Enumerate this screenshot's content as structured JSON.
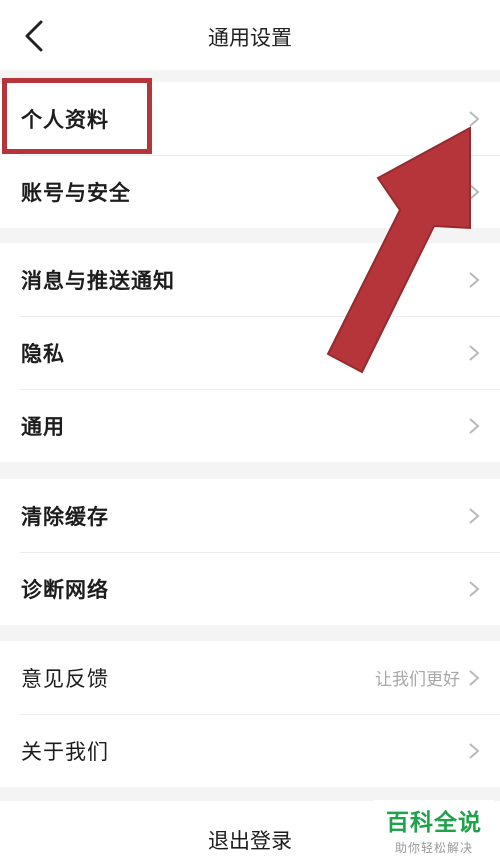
{
  "header": {
    "title": "通用设置"
  },
  "groups": [
    {
      "items": [
        {
          "label": "个人资料"
        },
        {
          "label": "账号与安全"
        }
      ]
    },
    {
      "items": [
        {
          "label": "消息与推送通知"
        },
        {
          "label": "隐私"
        },
        {
          "label": "通用"
        }
      ]
    },
    {
      "items": [
        {
          "label": "清除缓存"
        },
        {
          "label": "诊断网络"
        }
      ]
    },
    {
      "items": [
        {
          "label": "意见反馈",
          "hint": "让我们更好"
        },
        {
          "label": "关于我们"
        }
      ]
    }
  ],
  "logout": {
    "label": "退出登录"
  },
  "watermark": {
    "brand": "百科全说",
    "slogan": "助你轻松解决"
  },
  "colors": {
    "annotation": "#b5353a",
    "watermark_brand": "#1ea34a",
    "background": "#f4f4f4"
  },
  "icons": {
    "back": "chevron-left-icon",
    "row": "chevron-right-icon"
  }
}
